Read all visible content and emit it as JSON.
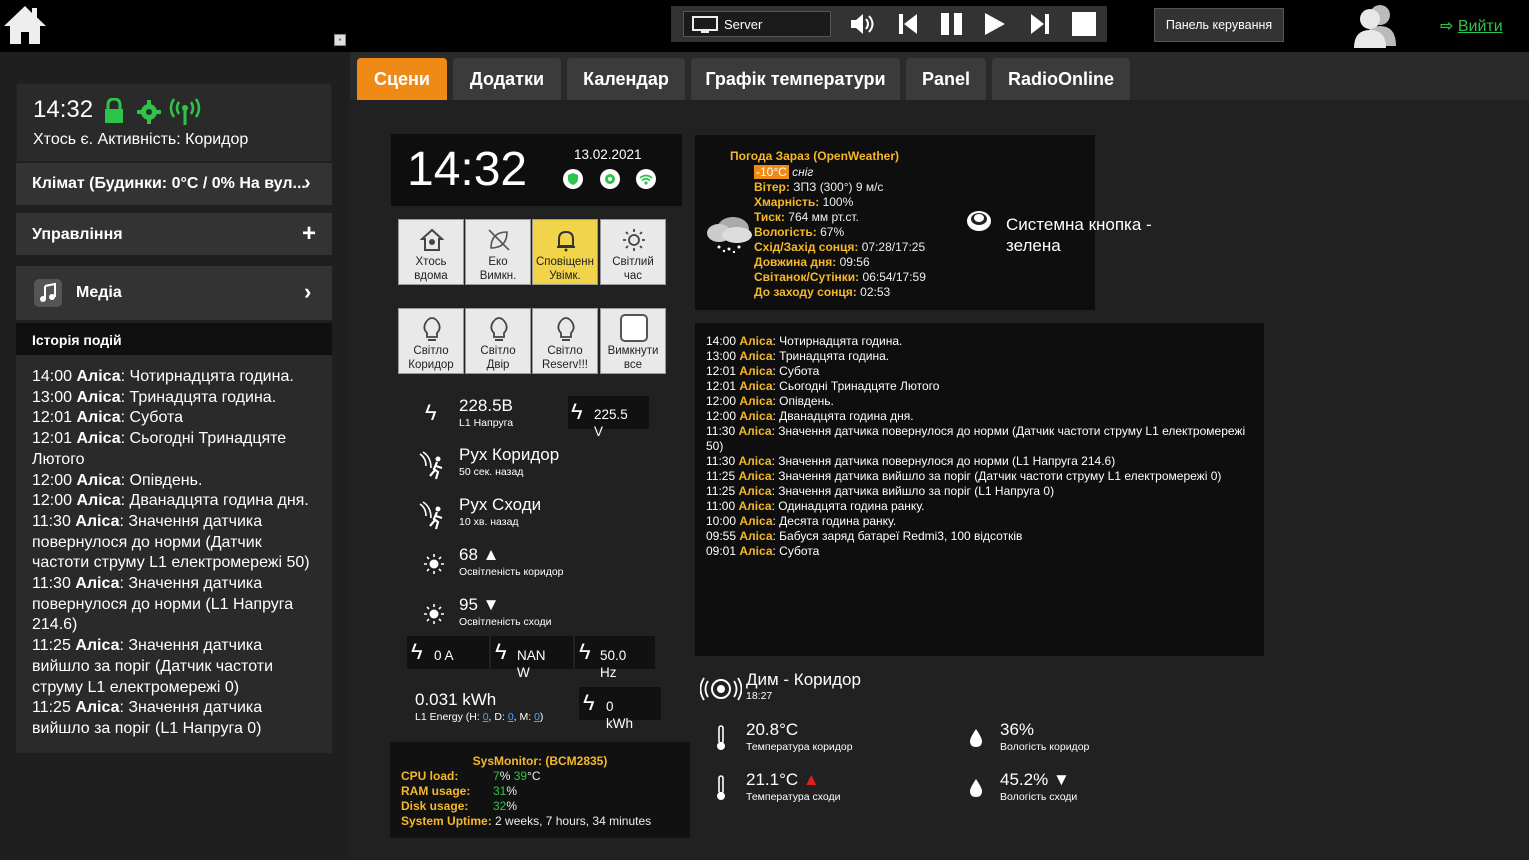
{
  "topbar": {
    "media_source": "Server",
    "control_panel": "Панель керування",
    "logout": "Вийти"
  },
  "sidebar": {
    "time": "14:32",
    "presence": "Хтось є. Активність: Коридор",
    "climate": "Клімат (Будинки: 0°C / 0% На вул...",
    "control": "Управління",
    "media": "Медіа",
    "history_title": "Історія подій",
    "history": [
      {
        "time": "14:00",
        "who": "Аліса",
        "text": ": Чотирнадцята година."
      },
      {
        "time": "13:00",
        "who": "Аліса",
        "text": ": Тринадцята година."
      },
      {
        "time": "12:01",
        "who": "Аліса",
        "text": ": Субота"
      },
      {
        "time": "12:01",
        "who": "Аліса",
        "text": ": Сьогодні Тринадцяте Лютого"
      },
      {
        "time": "12:00",
        "who": "Аліса",
        "text": ": Опівдень."
      },
      {
        "time": "12:00",
        "who": "Аліса",
        "text": ": Дванадцята година дня."
      },
      {
        "time": "11:30",
        "who": "Аліса",
        "text": ": Значення датчика повернулося до норми (Датчик частоти струму L1 електромережі 50)"
      },
      {
        "time": "11:30",
        "who": "Аліса",
        "text": ": Значення датчика повернулося до норми (L1 Напруга 214.6)"
      },
      {
        "time": "11:25",
        "who": "Аліса",
        "text": ": Значення датчика вийшло за поріг (Датчик частоти струму L1 електромережі 0)"
      },
      {
        "time": "11:25",
        "who": "Аліса",
        "text": ": Значення датчика вийшло за поріг (L1 Напруга 0)"
      }
    ]
  },
  "tabs": [
    "Сцени",
    "Додатки",
    "Календар",
    "Графік температури",
    "Panel",
    "RadioOnline"
  ],
  "clock": {
    "time": "14:32",
    "date": "13.02.2021"
  },
  "scenes_row1": [
    {
      "l1": "Хтось",
      "l2": "вдома",
      "icon": "home-icon"
    },
    {
      "l1": "Еко",
      "l2": "Вимкн.",
      "icon": "eco-off-icon"
    },
    {
      "l1": "Сповіщенн",
      "l2": "Увімк.",
      "icon": "bell-icon"
    },
    {
      "l1": "Світлий",
      "l2": "час",
      "icon": "sun-icon"
    }
  ],
  "scenes_row2": [
    {
      "l1": "Світло",
      "l2": "Коридор",
      "icon": "bulb-icon"
    },
    {
      "l1": "Світло",
      "l2": "Двір",
      "icon": "bulb-icon"
    },
    {
      "l1": "Світло",
      "l2": "Reserv!!!",
      "icon": "bulb-icon"
    },
    {
      "l1": "Вимкнути",
      "l2": "все",
      "icon": "square-icon"
    }
  ],
  "sensors": {
    "voltage": {
      "value": "228.5B",
      "label": "L1 Напруга"
    },
    "voltage_box": {
      "value": "225.5",
      "unit": "V"
    },
    "motion_corridor": {
      "value": "Рух Коридор",
      "label": "50 сек. назад"
    },
    "motion_stairs": {
      "value": "Рух Сходи",
      "label": "10 хв. назад"
    },
    "light_corridor": {
      "value": "68",
      "label": "Освітленість коридор"
    },
    "light_stairs": {
      "value": "95",
      "label": "Освітленість сходи"
    },
    "current": {
      "value": "0 A"
    },
    "power": {
      "value": "NAN",
      "unit": "W"
    },
    "freq": {
      "value": "50.0",
      "unit": "Hz"
    },
    "energy": {
      "value": "0.031 kWh",
      "label_pre": "L1 Energy (H: ",
      "h": "0",
      "d": "0",
      "m": "0"
    },
    "energy_box": {
      "value": "0",
      "unit": "kWh"
    }
  },
  "sysmon": {
    "title": "SysMonitor: (BCM2835)",
    "cpu_label": "CPU load:",
    "cpu_val": "7",
    "cpu_temp": "39",
    "ram_label": "RAM usage:",
    "ram_val": "31",
    "disk_label": "Disk usage:",
    "disk_val": "32",
    "uptime_label": "System Uptime:",
    "uptime_val": "2 weeks, 7 hours, 34 minutes"
  },
  "weather": {
    "title": "Погода Зараз (OpenWeather)",
    "temp": "-10°C",
    "cond": "сніг",
    "rows": [
      {
        "k": "Вітер:",
        "v": "ЗПЗ (300°) 9 м/с"
      },
      {
        "k": "Хмарність:",
        "v": "100%"
      },
      {
        "k": "Тиск:",
        "v": "764 мм рт.ст."
      },
      {
        "k": "Вологість:",
        "v": "67%"
      },
      {
        "k": "Схід/Захід сонця:",
        "v": "07:28/17:25"
      },
      {
        "k": "Довжина дня:",
        "v": "09:56"
      },
      {
        "k": "Світанок/Сутінки:",
        "v": "06:54/17:59"
      },
      {
        "k": "До заходу сонця:",
        "v": "02:53"
      }
    ]
  },
  "system_button": {
    "l1": "Системна кнопка -",
    "l2": "зелена"
  },
  "log": [
    {
      "t": "14:00",
      "w": "Аліса",
      "x": ": Чотирнадцята година."
    },
    {
      "t": "13:00",
      "w": "Аліса",
      "x": ": Тринадцята година."
    },
    {
      "t": "12:01",
      "w": "Аліса",
      "x": ": Субота"
    },
    {
      "t": "12:01",
      "w": "Аліса",
      "x": ": Сьогодні Тринадцяте Лютого"
    },
    {
      "t": "12:00",
      "w": "Аліса",
      "x": ": Опівдень."
    },
    {
      "t": "12:00",
      "w": "Аліса",
      "x": ": Дванадцята година дня."
    },
    {
      "t": "11:30",
      "w": "Аліса",
      "x": ": Значення датчика повернулося до норми (Датчик частоти струму L1 електромережі 50)"
    },
    {
      "t": "11:30",
      "w": "Аліса",
      "x": ": Значення датчика повернулося до норми (L1 Напруга 214.6)"
    },
    {
      "t": "11:25",
      "w": "Аліса",
      "x": ": Значення датчика вийшло за поріг (Датчик частоти струму L1 електромережі 0)"
    },
    {
      "t": "11:25",
      "w": "Аліса",
      "x": ": Значення датчика вийшло за поріг (L1 Напруга 0)"
    },
    {
      "t": "11:00",
      "w": "Аліса",
      "x": ": Одинадцята година ранку."
    },
    {
      "t": "10:00",
      "w": "Аліса",
      "x": ": Десята година ранку."
    },
    {
      "t": "09:55",
      "w": "Аліса",
      "x": ": Бабуся заряд батареї Redmi3, 100 відсотків"
    },
    {
      "t": "09:01",
      "w": "Аліса",
      "x": ": Субота"
    }
  ],
  "smoke": {
    "title": "Дим - Коридор",
    "time": "18:27"
  },
  "climate": {
    "temp_corr": {
      "value": "20.8°C",
      "label": "Температура коридор"
    },
    "hum_corr": {
      "value": "36%",
      "label": "Вологість коридор"
    },
    "temp_stairs": {
      "value": "21.1°C",
      "label": "Температура сходи"
    },
    "hum_stairs": {
      "value": "45.2%",
      "label": "Вологість сходи"
    }
  },
  "colors": {
    "accent": "#f08a16",
    "green": "#2ec44a",
    "yellow": "#f5b829",
    "red": "#e02020"
  }
}
